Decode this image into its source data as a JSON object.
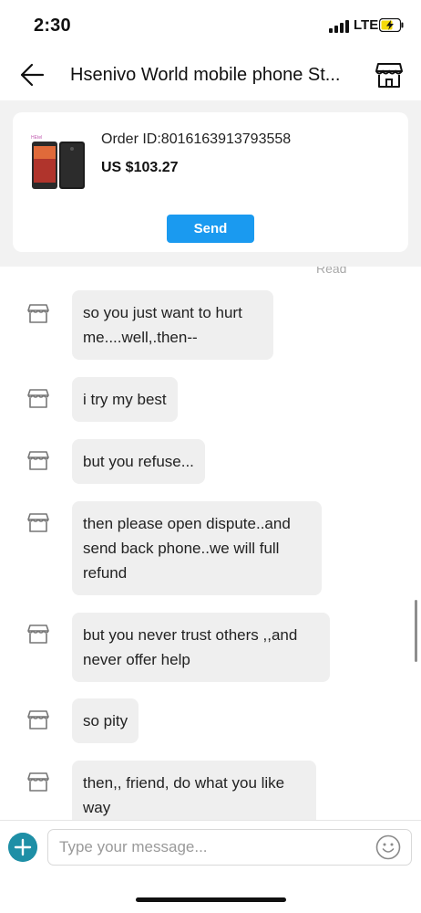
{
  "status_bar": {
    "time": "2:30",
    "network": "LTE",
    "signal_icon": "signal-bars-icon",
    "battery_icon": "battery-charging-icon",
    "battery_color": "#f5d90a"
  },
  "header": {
    "back_icon": "back-arrow-icon",
    "title": "Hsenivo World mobile phone St...",
    "store_icon": "store-icon"
  },
  "order_card": {
    "order_id": "Order ID:8016163913793558",
    "price": "US $103.27",
    "send_label": "Send",
    "thumbnail": "phone-product-image"
  },
  "chat": {
    "read_label": "Read",
    "messages": [
      {
        "text": "so you just want to hurt me....well,.then--"
      },
      {
        "text": "i try my best"
      },
      {
        "text": "but you refuse..."
      },
      {
        "text": "then please open dispute..and send back phone..we will full refund"
      },
      {
        "text": "but you never trust others ,,and never offer help"
      },
      {
        "text": "so pity"
      },
      {
        "text": "then,, friend, do what you like way"
      }
    ]
  },
  "composer": {
    "placeholder": "Type your message...",
    "add_icon": "plus-icon",
    "emoji_icon": "smiley-icon"
  },
  "colors": {
    "accent": "#1a9af0",
    "add_button": "#1e8fa6",
    "bubble": "#efefef",
    "order_background": "#f2f2f2"
  }
}
